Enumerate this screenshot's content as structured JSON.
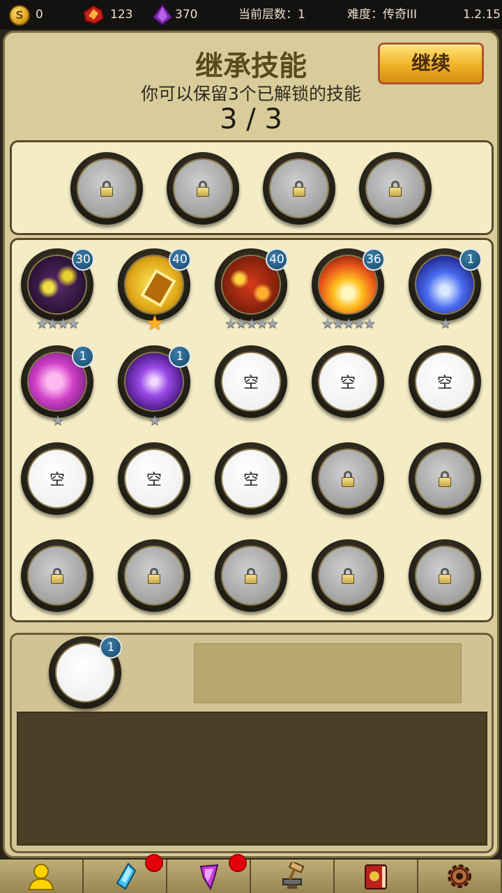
{
  "status": {
    "gold": "0",
    "red_gems": "123",
    "purple_gems": "370",
    "floor": "当前层数：1",
    "difficulty": "难度：传奇III",
    "version": "1.2.15"
  },
  "header": {
    "title": "继承技能",
    "subtitle": "你可以保留3个已解锁的技能",
    "counter": "3 / 3",
    "continue_label": "继续"
  },
  "kept_slots": [
    "locked",
    "locked",
    "locked",
    "locked"
  ],
  "grid": {
    "empty_label": "空",
    "skills": [
      {
        "icon": "shadow-storm-icon",
        "level": "30",
        "stars": "★★★★"
      },
      {
        "icon": "golden-shield-icon",
        "level": "40",
        "stars": "★"
      },
      {
        "icon": "lava-burst-icon",
        "level": "40",
        "stars": "★★★★★"
      },
      {
        "icon": "fire-blast-icon",
        "level": "36",
        "stars": "★★★★★"
      },
      {
        "icon": "ice-lightning-icon",
        "level": "1",
        "stars": "★"
      },
      {
        "icon": "pink-vortex-icon",
        "level": "1",
        "stars": "★"
      },
      {
        "icon": "arcane-burst-icon",
        "level": "1",
        "stars": "★"
      }
    ]
  },
  "selected": {
    "level": "1"
  },
  "nav": [
    {
      "icon": "hero-icon"
    },
    {
      "icon": "crystal-icon"
    },
    {
      "icon": "gem-icon"
    },
    {
      "icon": "forge-icon"
    },
    {
      "icon": "spellbook-icon"
    },
    {
      "icon": "settings-gear-icon"
    }
  ],
  "colors": {
    "accent": "#f0b227",
    "badge": "#1e5a80",
    "notification": "#e4000a"
  }
}
